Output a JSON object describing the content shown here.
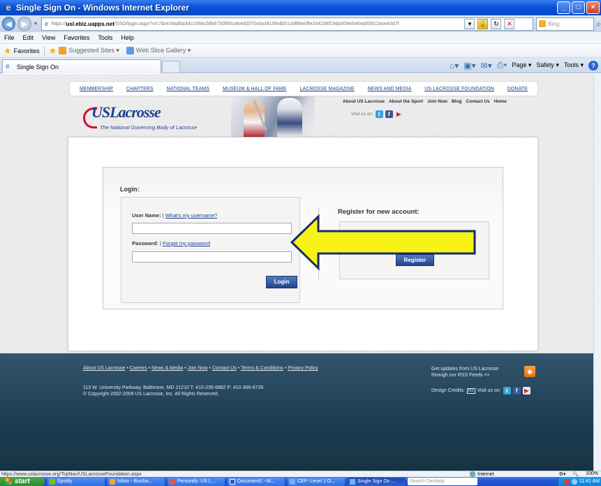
{
  "window": {
    "title": "Single Sign On - Windows Internet Explorer",
    "controls": [
      "_",
      "□",
      "×"
    ]
  },
  "address": {
    "url_prefix": "https://",
    "url_domain": "usl.ebiz.uapps.net",
    "url_path": "/SSO/login.aspx?vi=7&vt=9ad6d3dc156bc56b6750f65ca64dd370c6a3815f4db51cbf86e0ffe334238f19da50945464a50912ace43d7f",
    "search_placeholder": "Bing"
  },
  "menu": [
    "File",
    "Edit",
    "View",
    "Favorites",
    "Tools",
    "Help"
  ],
  "favorites_bar": {
    "label": "Favorites",
    "items": [
      "Suggested Sites ▾",
      "Web Slice Gallery ▾"
    ]
  },
  "tab": {
    "label": "Single Sign On"
  },
  "command_bar": [
    "Page ▾",
    "Safety ▾",
    "Tools ▾"
  ],
  "site": {
    "nav": [
      "MEMBERSHIP",
      "CHAPTERS",
      "NATIONAL TEAMS",
      "MUSEUM & HALL OF FAME",
      "LACROSSE MAGAZINE",
      "NEWS AND MEDIA",
      "US LACROSSE FOUNDATION",
      "DONATE"
    ],
    "logo_text": "USLacrosse",
    "tagline": "The National Governing Body of Lacrosse",
    "top_links": [
      "About US Lacrosse",
      "About the Sport",
      "Join Now",
      "Blog",
      "Contact Us",
      "Home"
    ],
    "visit_us": "Visit us on:"
  },
  "login": {
    "heading": "Login:",
    "username_label": "User Name:",
    "username_help": "What's my username?",
    "username_value": "",
    "password_label": "Password:",
    "password_help": "Forgot my password",
    "password_value": "",
    "login_button": "Login",
    "register_heading": "Register for new account:",
    "register_button": "Register"
  },
  "footer": {
    "links": [
      "About US Lacrosse",
      "Careers",
      "News & Media",
      "Join Now",
      "Contact Us",
      "Terms & Conditions",
      "Privacy Policy"
    ],
    "address_line1": "113 W. University Parkway, Baltimore, MD 21210    T: 410-235-6882    F: 410-366-6735",
    "address_line2": "© Copyright 2002-2009 US Lacrosse, Inc. All Rights Reserved.",
    "rss_line1": "Get updates from US Lacrosse",
    "rss_line2": "through our RSS Feeds >>",
    "credits_label": "Design Credits:",
    "credits_badge": "R2",
    "visit_label": "Visit us on:"
  },
  "status": {
    "url": "https://www.uslacrosse.org/TopNav/USLacrosseFoundation.aspx",
    "zone": "Internet",
    "zoom": "100%"
  },
  "taskbar": {
    "start": "start",
    "items": [
      "Spotify",
      "Inbox - tbucha...",
      "Personify: US L...",
      "Document1 - M...",
      "CEP: Level 1 O...",
      "Single Sign On ..."
    ],
    "search_placeholder": "Search Desktop",
    "clock": "11:41 AM"
  },
  "colors": {
    "accent_yellow": "#f7f316",
    "arrow_outline": "#1c2a6e",
    "button_blue": "#23468d",
    "footer_band": "#1c3c52"
  }
}
